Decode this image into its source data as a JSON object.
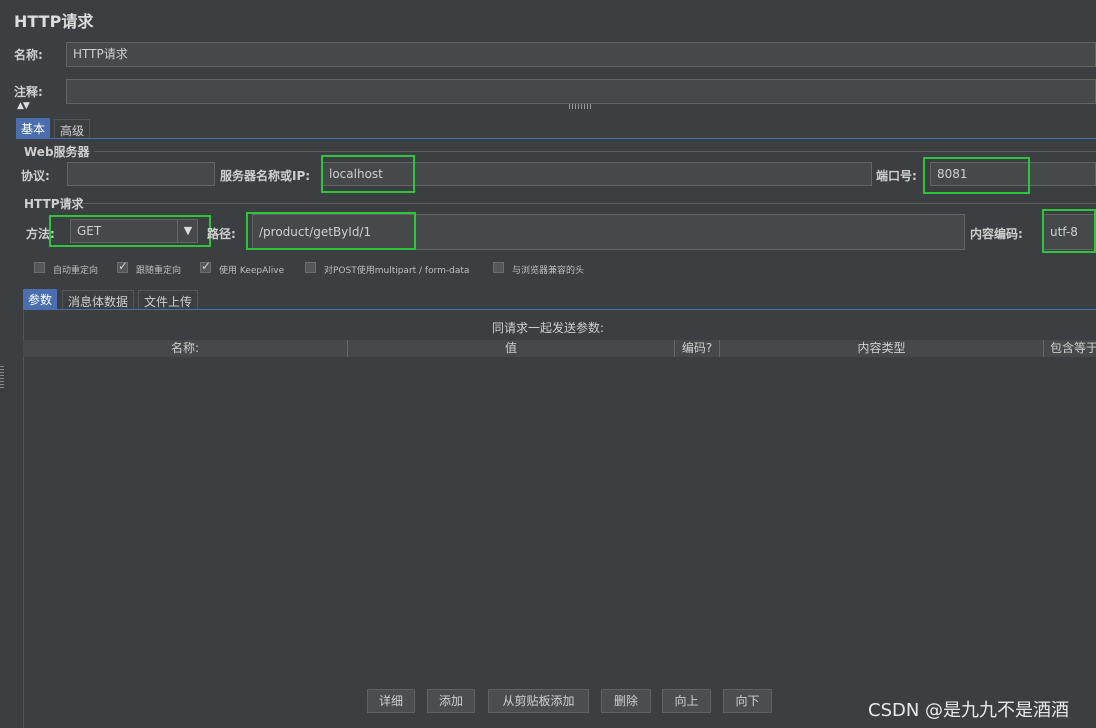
{
  "panel_title": "HTTP请求",
  "name_field": {
    "label": "名称:",
    "value": "HTTP请求"
  },
  "comment_field": {
    "label": "注释:",
    "value": ""
  },
  "tabs": {
    "basic": "基本",
    "advanced": "高级"
  },
  "web_server": {
    "section_title": "Web服务器",
    "protocol_label": "协议:",
    "protocol_value": "",
    "server_label": "服务器名称或IP:",
    "server_value": "localhost",
    "port_label": "端口号:",
    "port_value": "8081"
  },
  "http_request": {
    "section_title": "HTTP请求",
    "method_label": "方法:",
    "method_value": "GET",
    "path_label": "路径:",
    "path_value": "/product/getById/1",
    "encoding_label": "内容编码:",
    "encoding_value": "utf-8"
  },
  "checkboxes": [
    {
      "label": "自动重定向",
      "checked": false
    },
    {
      "label": "跟随重定向",
      "checked": true
    },
    {
      "label": "使用 KeepAlive",
      "checked": true
    },
    {
      "label": "对POST使用multipart / form-data",
      "checked": false
    },
    {
      "label": "与浏览器兼容的头",
      "checked": false
    }
  ],
  "sub_tabs": {
    "params": "参数",
    "body": "消息体数据",
    "files": "文件上传"
  },
  "params_table": {
    "caption": "同请求一起发送参数:",
    "columns": [
      "名称:",
      "值",
      "编码?",
      "内容类型",
      "包含等于"
    ]
  },
  "buttons": {
    "detail": "详细",
    "add": "添加",
    "add_clipboard": "从剪贴板添加",
    "delete": "删除",
    "up": "向上",
    "down": "向下"
  },
  "watermark": "CSDN @是九九不是酒酒",
  "colors": {
    "highlight": "#2ec43b",
    "active_tab": "#4b6eaf",
    "background": "#3c3f41"
  }
}
